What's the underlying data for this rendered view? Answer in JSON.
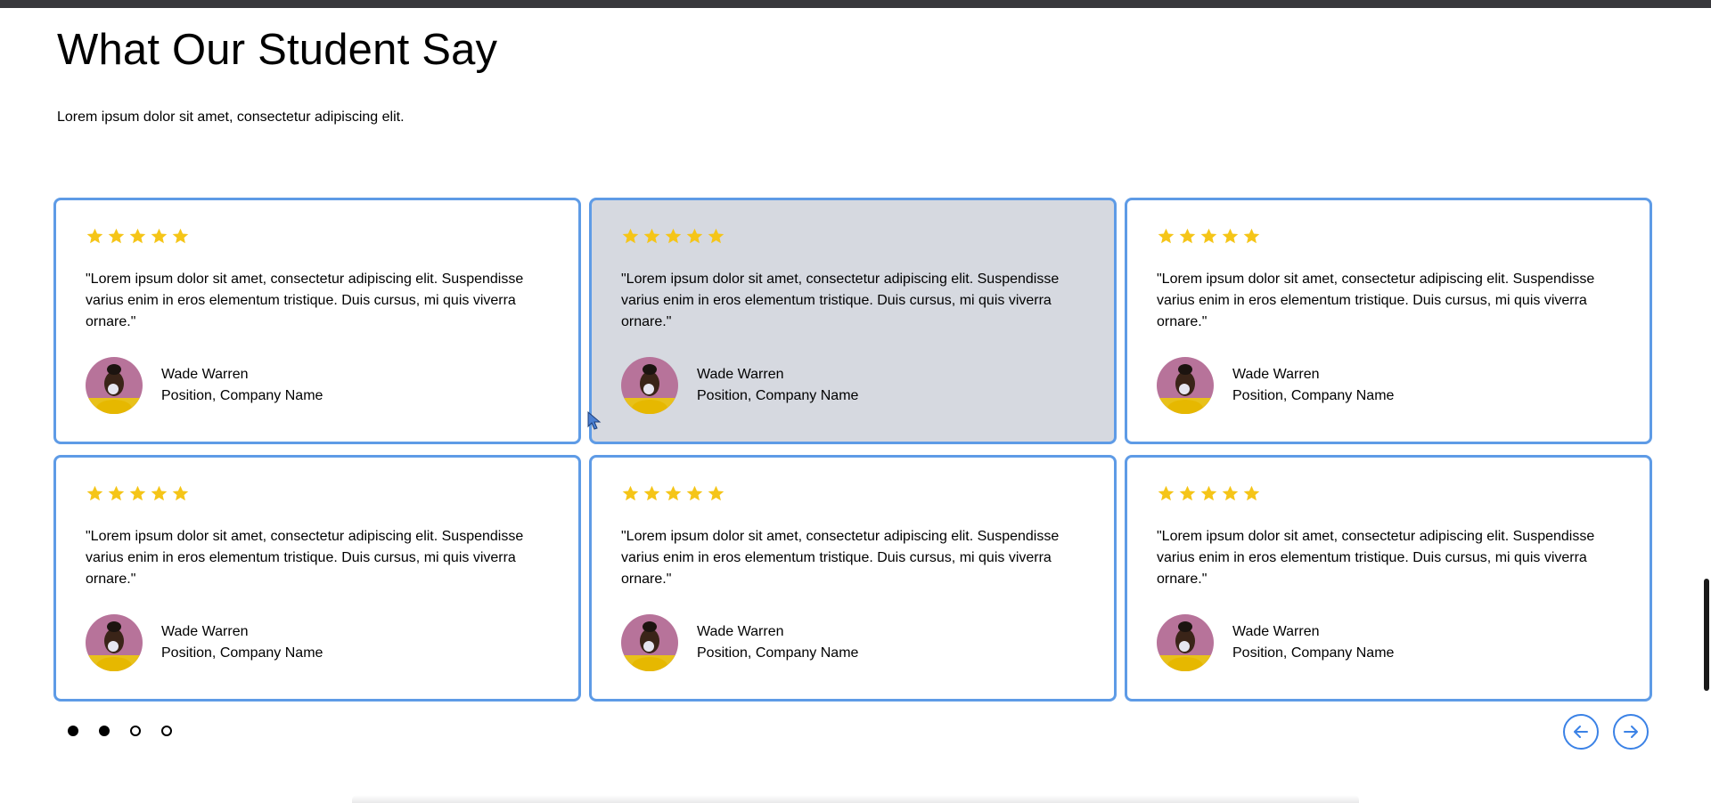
{
  "section": {
    "title": "What Our Student Say",
    "subtitle": "Lorem ipsum dolor sit amet, consectetur adipiscing elit."
  },
  "testimonials": [
    {
      "rating": 5,
      "quote": "\"Lorem ipsum dolor sit amet, consectetur adipiscing elit. Suspendisse varius enim in eros elementum tristique. Duis cursus, mi quis viverra ornare.\"",
      "name": "Wade Warren",
      "position": "Position, Company Name",
      "avatar_icon": "user-avatar"
    },
    {
      "rating": 5,
      "quote": "\"Lorem ipsum dolor sit amet, consectetur adipiscing elit. Suspendisse varius enim in eros elementum tristique. Duis cursus, mi quis viverra ornare.\"",
      "name": "Wade Warren",
      "position": "Position, Company Name",
      "avatar_icon": "user-avatar",
      "hovered": true
    },
    {
      "rating": 5,
      "quote": "\"Lorem ipsum dolor sit amet, consectetur adipiscing elit. Suspendisse varius enim in eros elementum tristique. Duis cursus, mi quis viverra ornare.\"",
      "name": "Wade Warren",
      "position": "Position, Company Name",
      "avatar_icon": "user-avatar"
    },
    {
      "rating": 5,
      "quote": "\"Lorem ipsum dolor sit amet, consectetur adipiscing elit. Suspendisse varius enim in eros elementum tristique. Duis cursus, mi quis viverra ornare.\"",
      "name": "Wade Warren",
      "position": "Position, Company Name",
      "avatar_icon": "user-avatar"
    },
    {
      "rating": 5,
      "quote": "\"Lorem ipsum dolor sit amet, consectetur adipiscing elit. Suspendisse varius enim in eros elementum tristique. Duis cursus, mi quis viverra ornare.\"",
      "name": "Wade Warren",
      "position": "Position, Company Name",
      "avatar_icon": "user-avatar"
    },
    {
      "rating": 5,
      "quote": "\"Lorem ipsum dolor sit amet, consectetur adipiscing elit. Suspendisse varius enim in eros elementum tristique. Duis cursus, mi quis viverra ornare.\"",
      "name": "Wade Warren",
      "position": "Position, Company Name",
      "avatar_icon": "user-avatar"
    }
  ],
  "pagination": {
    "dots": [
      true,
      true,
      false,
      false
    ],
    "prev_icon": "arrow-left-circle-icon",
    "next_icon": "arrow-right-circle-icon"
  },
  "colors": {
    "card_border": "#5e9be6",
    "card_hover_bg": "#d6d9e0",
    "star": "#f5c518",
    "nav_accent": "#3b82e6"
  }
}
